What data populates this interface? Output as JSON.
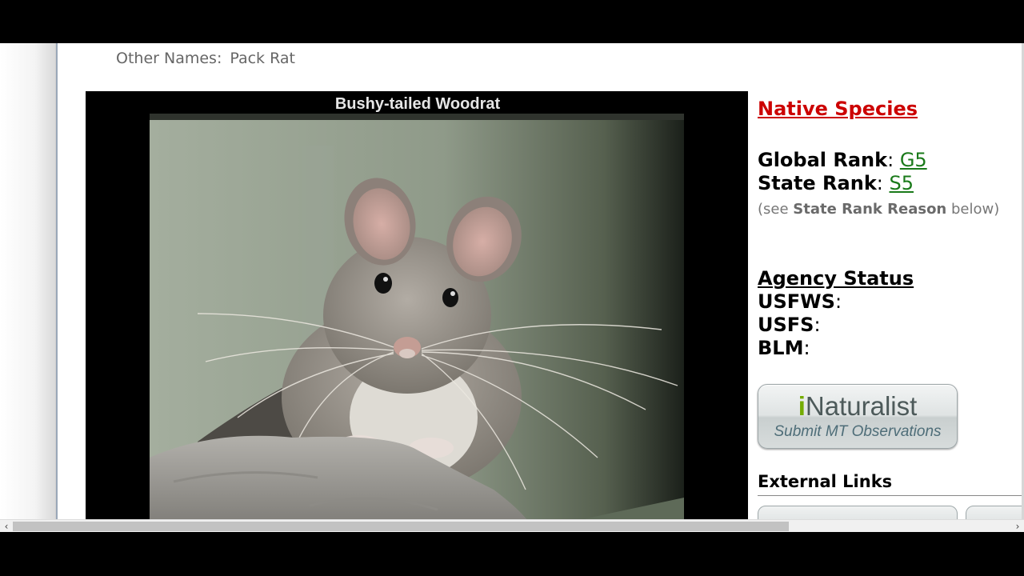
{
  "other_names": {
    "label": "Other Names:",
    "value": "Pack Rat"
  },
  "photo": {
    "title": "Bushy-tailed Woodrat"
  },
  "sidebar": {
    "native_species": "Native Species",
    "global_rank_label": "Global Rank",
    "global_rank_value": "G5",
    "state_rank_label": "State Rank",
    "state_rank_value": "S5",
    "rank_note_prefix": "(see ",
    "rank_note_bold": "State Rank Reason",
    "rank_note_suffix": " below)",
    "agency_title": "Agency Status",
    "agencies": [
      "USFWS",
      "USFS",
      "BLM"
    ],
    "inaturalist": {
      "brand_i": "i",
      "brand_rest": "Naturalist",
      "subtitle": "Submit MT Observations"
    },
    "external_links": "External Links"
  },
  "scrollbar": {
    "left_arrow": "‹",
    "right_arrow": "›"
  },
  "colors": {
    "native_red": "#cc0000",
    "rank_link_green": "#1a7a1a",
    "inat_green": "#74ac00"
  }
}
